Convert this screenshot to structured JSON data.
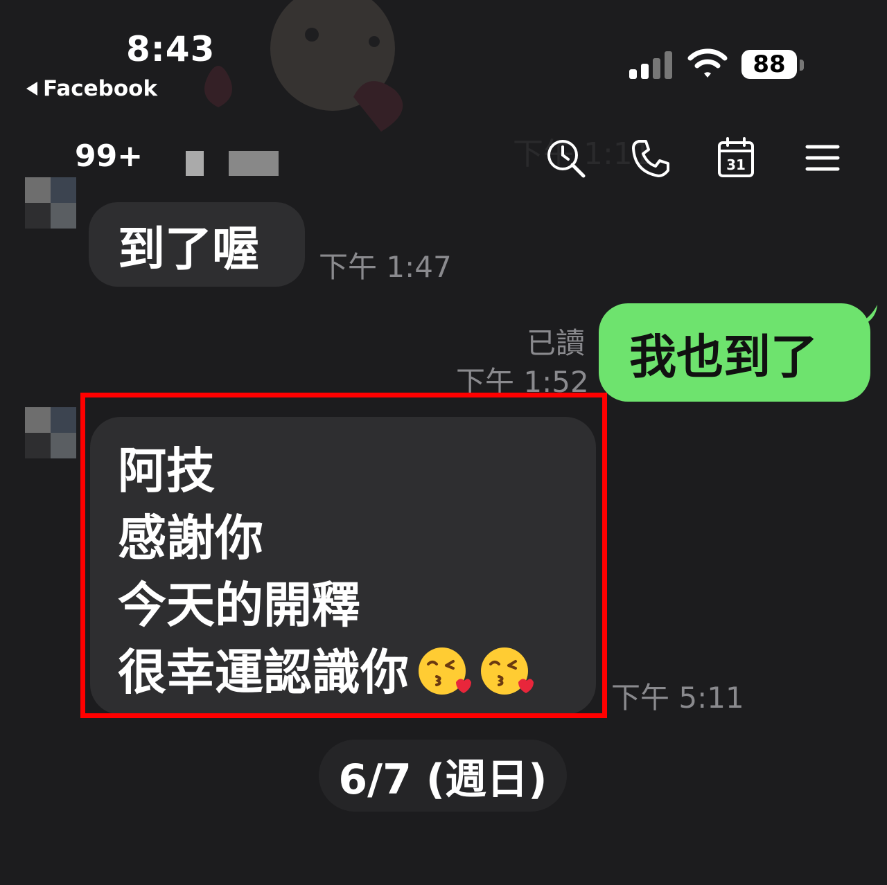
{
  "status_bar": {
    "time": "8:43",
    "back_app": "Facebook",
    "battery": "88"
  },
  "header": {
    "unread_count": "99+",
    "icons": [
      "search-clock-icon",
      "phone-icon",
      "calendar-icon",
      "menu-icon"
    ],
    "calendar_day": "31",
    "faded_time": "下午 1:11"
  },
  "messages": [
    {
      "direction": "incoming",
      "text": "到了喔",
      "time": "下午 1:47"
    },
    {
      "direction": "outgoing",
      "text": "我也到了",
      "read": "已讀",
      "time": "下午 1:52"
    },
    {
      "direction": "incoming",
      "lines": [
        "阿技",
        "感謝你",
        "今天的開釋",
        "很幸運認識你"
      ],
      "emoji": [
        "kissing-heart-emoji",
        "kissing-heart-emoji"
      ],
      "time": "下午 5:11",
      "highlighted": true
    }
  ],
  "date_separator": "6/7 (週日)",
  "colors": {
    "background": "#1c1c1e",
    "incoming_bubble": "#2e2e30",
    "outgoing_bubble": "#6ee36e",
    "highlight": "#ff0000"
  }
}
